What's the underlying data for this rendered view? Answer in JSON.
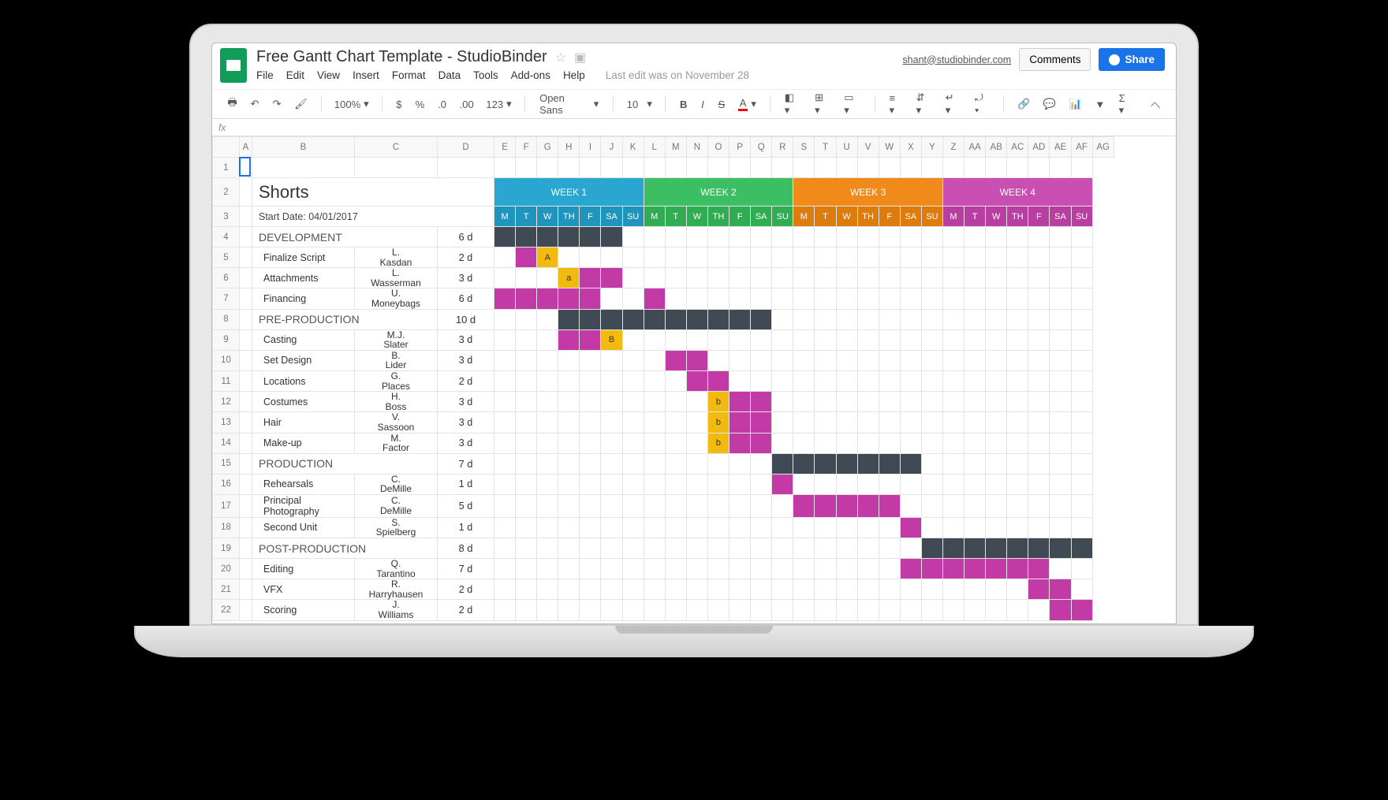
{
  "doc": {
    "title": "Free Gantt Chart Template - StudioBinder",
    "user_email": "shant@studiobinder.com",
    "comments_label": "Comments",
    "share_label": "Share",
    "last_edit": "Last edit was on November 28",
    "fx": "fx"
  },
  "menus": [
    "File",
    "Edit",
    "View",
    "Insert",
    "Format",
    "Data",
    "Tools",
    "Add-ons",
    "Help"
  ],
  "toolbar": {
    "zoom": "100%",
    "currency": "$",
    "percent": "%",
    "dec_less": ".0",
    "dec_more": ".00",
    "numfmt": "123",
    "font": "Open Sans",
    "size": "10"
  },
  "columns": [
    "A",
    "B",
    "C",
    "D",
    "E",
    "F",
    "G",
    "H",
    "I",
    "J",
    "K",
    "L",
    "M",
    "N",
    "O",
    "P",
    "Q",
    "R",
    "S",
    "T",
    "U",
    "V",
    "W",
    "X",
    "Y",
    "Z",
    "AA",
    "AB",
    "AC",
    "AD",
    "AE",
    "AF",
    "AG"
  ],
  "weeks": [
    {
      "label": "WEEK 1",
      "hdr": "w1",
      "day": "w1d"
    },
    {
      "label": "WEEK 2",
      "hdr": "w2",
      "day": "w2d"
    },
    {
      "label": "WEEK 3",
      "hdr": "w3",
      "day": "w3d"
    },
    {
      "label": "WEEK 4",
      "hdr": "w4",
      "day": "w4d"
    }
  ],
  "day_labels": [
    "M",
    "T",
    "W",
    "TH",
    "F",
    "SA",
    "SU"
  ],
  "sheet_title": "Shorts",
  "start_date_label": "Start Date: 04/01/2017",
  "chart_data": {
    "type": "gantt",
    "start_date": "04/01/2017",
    "num_days": 28,
    "rows": [
      {
        "type": "section",
        "rownum": 4,
        "name": "DEVELOPMENT",
        "duration": "6 d",
        "span": [
          0,
          6
        ]
      },
      {
        "type": "task",
        "rownum": 5,
        "name": "Finalize Script",
        "assignee": "L. Kasdan",
        "duration": "2 d",
        "bars": [
          {
            "start": 1,
            "len": 1,
            "cls": "bar-task"
          },
          {
            "start": 2,
            "len": 1,
            "cls": "bar-mark",
            "label": "A"
          }
        ]
      },
      {
        "type": "task",
        "rownum": 6,
        "name": "Attachments",
        "assignee": "L. Wasserman",
        "duration": "3 d",
        "bars": [
          {
            "start": 3,
            "len": 1,
            "cls": "bar-mark",
            "label": "a"
          },
          {
            "start": 4,
            "len": 2,
            "cls": "bar-task"
          }
        ]
      },
      {
        "type": "task",
        "rownum": 7,
        "name": "Financing",
        "assignee": "U. Moneybags",
        "duration": "6 d",
        "bars": [
          {
            "start": 0,
            "len": 5,
            "cls": "bar-task"
          },
          {
            "start": 7,
            "len": 1,
            "cls": "bar-task"
          }
        ]
      },
      {
        "type": "section",
        "rownum": 8,
        "name": "PRE-PRODUCTION",
        "duration": "10 d",
        "span": [
          3,
          10
        ]
      },
      {
        "type": "task",
        "rownum": 9,
        "name": "Casting",
        "assignee": "M.J. Slater",
        "duration": "3 d",
        "bars": [
          {
            "start": 3,
            "len": 2,
            "cls": "bar-task"
          },
          {
            "start": 5,
            "len": 1,
            "cls": "bar-mark",
            "label": "B"
          }
        ]
      },
      {
        "type": "task",
        "rownum": 10,
        "name": "Set Design",
        "assignee": "B. Lider",
        "duration": "3 d",
        "bars": [
          {
            "start": 8,
            "len": 2,
            "cls": "bar-task"
          }
        ]
      },
      {
        "type": "task",
        "rownum": 11,
        "name": "Locations",
        "assignee": "G. Places",
        "duration": "2 d",
        "bars": [
          {
            "start": 9,
            "len": 2,
            "cls": "bar-task"
          }
        ]
      },
      {
        "type": "task",
        "rownum": 12,
        "name": "Costumes",
        "assignee": "H. Boss",
        "duration": "3 d",
        "bars": [
          {
            "start": 10,
            "len": 1,
            "cls": "bar-mark",
            "label": "b"
          },
          {
            "start": 11,
            "len": 2,
            "cls": "bar-task"
          }
        ]
      },
      {
        "type": "task",
        "rownum": 13,
        "name": "Hair",
        "assignee": "V. Sassoon",
        "duration": "3 d",
        "bars": [
          {
            "start": 10,
            "len": 1,
            "cls": "bar-mark",
            "label": "b"
          },
          {
            "start": 11,
            "len": 2,
            "cls": "bar-task"
          }
        ]
      },
      {
        "type": "task",
        "rownum": 14,
        "name": "Make-up",
        "assignee": "M. Factor",
        "duration": "3 d",
        "bars": [
          {
            "start": 10,
            "len": 1,
            "cls": "bar-mark",
            "label": "b"
          },
          {
            "start": 11,
            "len": 2,
            "cls": "bar-task"
          }
        ]
      },
      {
        "type": "section",
        "rownum": 15,
        "name": "PRODUCTION",
        "duration": "7 d",
        "span": [
          13,
          7
        ]
      },
      {
        "type": "task",
        "rownum": 16,
        "name": "Rehearsals",
        "assignee": "C. DeMille",
        "duration": "1 d",
        "bars": [
          {
            "start": 13,
            "len": 1,
            "cls": "bar-task"
          }
        ]
      },
      {
        "type": "task",
        "rownum": 17,
        "name": "Principal Photography",
        "assignee": "C. DeMille",
        "duration": "5 d",
        "bars": [
          {
            "start": 14,
            "len": 5,
            "cls": "bar-task"
          }
        ]
      },
      {
        "type": "task",
        "rownum": 18,
        "name": "Second Unit",
        "assignee": "S. Spielberg",
        "duration": "1 d",
        "bars": [
          {
            "start": 19,
            "len": 1,
            "cls": "bar-task"
          }
        ]
      },
      {
        "type": "section",
        "rownum": 19,
        "name": "POST-PRODUCTION",
        "duration": "8 d",
        "span": [
          20,
          8
        ]
      },
      {
        "type": "task",
        "rownum": 20,
        "name": "Editing",
        "assignee": "Q. Tarantino",
        "duration": "7 d",
        "bars": [
          {
            "start": 19,
            "len": 7,
            "cls": "bar-task"
          }
        ]
      },
      {
        "type": "task",
        "rownum": 21,
        "name": "VFX",
        "assignee": "R. Harryhausen",
        "duration": "2 d",
        "bars": [
          {
            "start": 25,
            "len": 2,
            "cls": "bar-task"
          }
        ]
      },
      {
        "type": "task",
        "rownum": 22,
        "name": "Scoring",
        "assignee": "J. Williams",
        "duration": "2 d",
        "bars": [
          {
            "start": 26,
            "len": 2,
            "cls": "bar-task"
          }
        ]
      }
    ]
  }
}
